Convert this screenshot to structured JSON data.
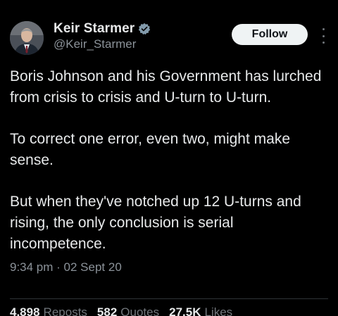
{
  "author": {
    "display_name": "Keir Starmer",
    "handle": "@Keir_Starmer",
    "verified_color": "#829aab"
  },
  "actions": {
    "follow_label": "Follow"
  },
  "tweet": {
    "paragraphs": [
      "Boris Johnson and his Government has lurched from crisis to crisis and U-turn to U-turn.",
      "To correct one error, even two, might make sense.",
      "But when they've notched up 12 U-turns and rising, the only conclusion is serial incompetence."
    ],
    "timestamp": "9:34 pm · 02 Sept 20"
  },
  "stats": [
    {
      "value": "4,898",
      "label": "Reposts"
    },
    {
      "value": "582",
      "label": "Quotes"
    },
    {
      "value": "27.5K",
      "label": "Likes"
    }
  ],
  "icons": {
    "verified": "verified-badge-icon",
    "more": "more-options-icon"
  }
}
